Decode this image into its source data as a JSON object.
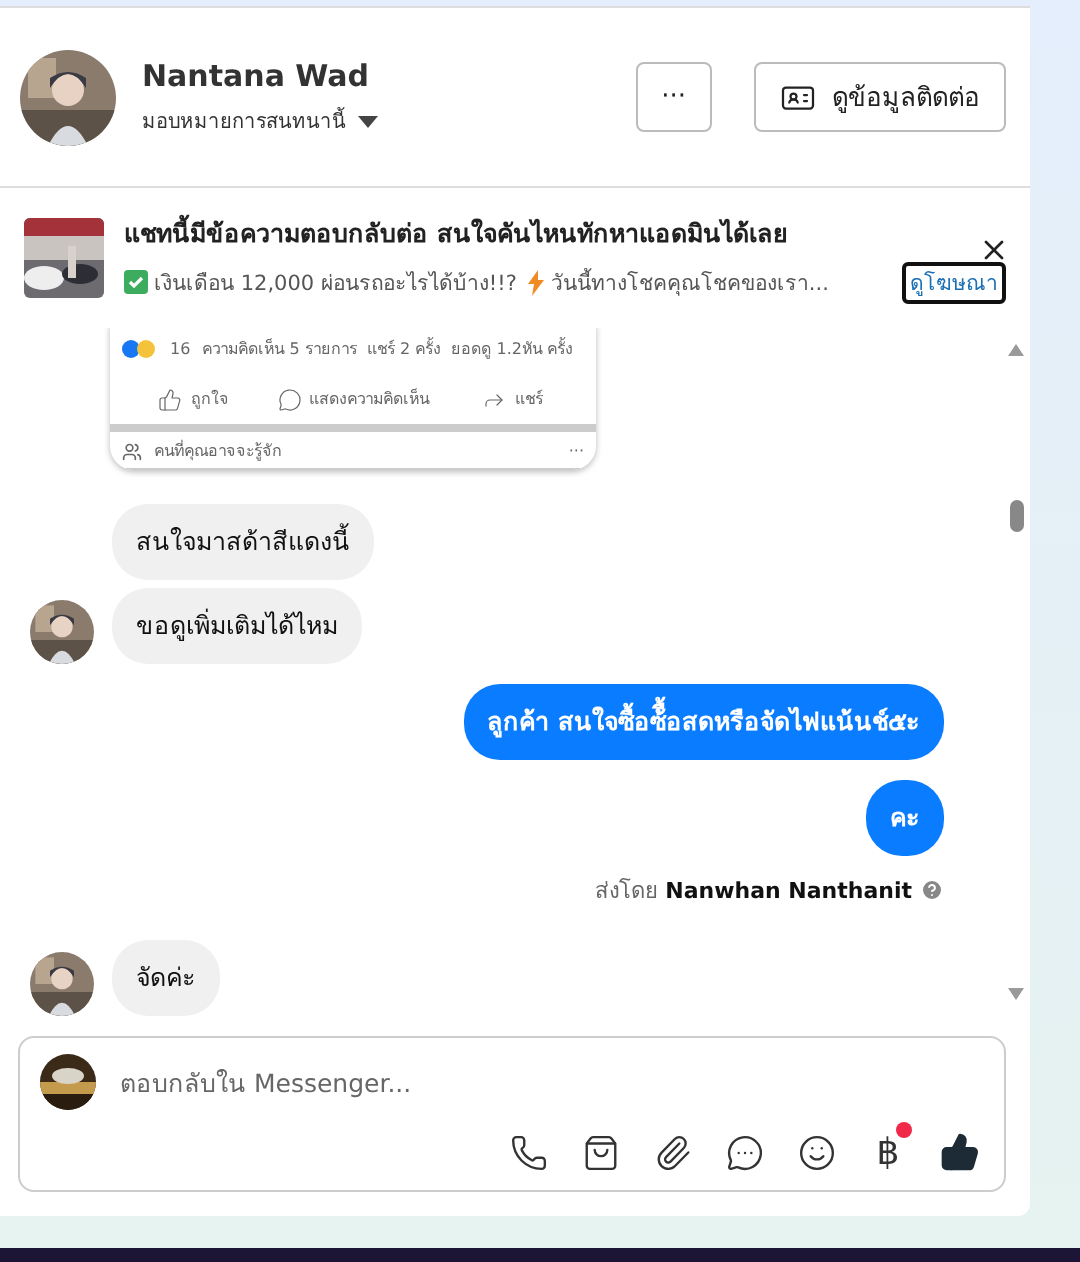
{
  "contact": {
    "name": "Nantana Wad",
    "assign_label": "มอบหมายการสนทนานี้",
    "more_button": "···",
    "contact_button": "ดูข้อมูลติดต่อ"
  },
  "ad": {
    "title": "แชทนี้มีข้อความตอบกลับต่อ สนใจคันไหนทักหาแอดมินได้เลย",
    "body_1": "เงินเดือน 12,000 ผ่อนรถอะไรได้บ้าง!!?",
    "body_2": "วันนี้ทางโชคคุณโชคของเรา...",
    "link": "ดูโฆษณา"
  },
  "shared_post": {
    "reaction_count": "16",
    "stats": "ความคิดเห็น 5 รายการ  แชร์ 2 ครั้ง  ยอดดู 1.2หัน ครั้ง",
    "actions": [
      {
        "kind": "like",
        "label": "ถูกใจ"
      },
      {
        "kind": "comment",
        "label": "แสดงความคิดเห็น"
      },
      {
        "kind": "share",
        "label": "แชร์"
      }
    ],
    "suggest": "คนที่คุณอาจจะรู้จัก",
    "more": "···"
  },
  "messages": [
    {
      "kind": "incoming",
      "text": "สนใจมาสด้าสีแดงนี้",
      "show_avatar": false
    },
    {
      "kind": "incoming",
      "text": "ขอดูเพิ่มเติมได้ไหม",
      "show_avatar": true
    },
    {
      "kind": "outgoing",
      "text": "ลูกค้า สนใจซื้อซ้ื้อสดหรือจัดไฟแน้นช์๕ะ"
    },
    {
      "kind": "outgoing",
      "text": "คะ"
    },
    {
      "kind": "sent_by",
      "prefix": "ส่งโดย",
      "name": "Nanwhan Nanthanit"
    },
    {
      "kind": "incoming",
      "text": "จัดค่ะ",
      "show_avatar": true
    }
  ],
  "composer": {
    "placeholder": "ตอบกลับใน Messenger...",
    "tools": [
      {
        "kind": "call",
        "badge": false
      },
      {
        "kind": "store",
        "badge": false
      },
      {
        "kind": "attach",
        "badge": false
      },
      {
        "kind": "saved-reply",
        "badge": false
      },
      {
        "kind": "emoji",
        "badge": false
      },
      {
        "kind": "payment",
        "label": "฿",
        "badge": true
      },
      {
        "kind": "like",
        "badge": false
      }
    ]
  }
}
